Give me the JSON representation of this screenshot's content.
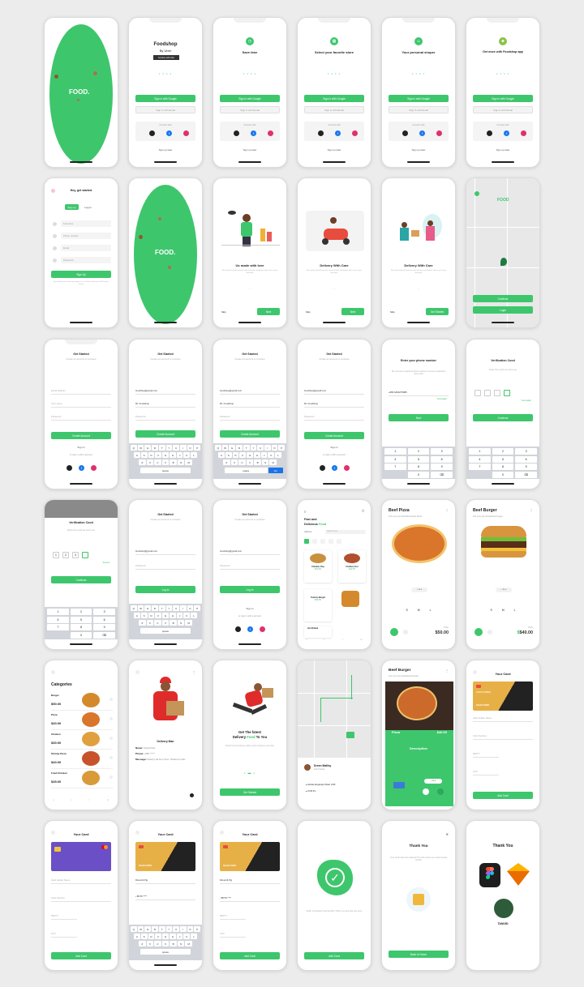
{
  "colors": {
    "accent": "#3ec66d",
    "background": "#ececec",
    "card_dark": "#222222",
    "card_gold": "#e7b046",
    "card_purple": "#6a4fc7"
  },
  "row1": {
    "splash_logo": "FOOD.",
    "foodshop_title": "Foodshop",
    "foodshop_by": "By Uber",
    "foodshop_badge": "Continue with Uber",
    "save_time": "Save time",
    "select_store": "Select your favorite store",
    "personal_shoper": "Your personal shoper",
    "get_more": "Get more with Foodshop app",
    "sign_in_google": "Sign in with Google",
    "sign_in_email": "Sign in with Email",
    "connect_with": "Connect with",
    "sign_up_later": "Sign up later"
  },
  "row2": {
    "get_started": "Hey, get started",
    "tab_signup": "Sign up",
    "tab_login": "Log in",
    "field_name": "Full name",
    "field_phone": "Phone number",
    "field_email": "Email",
    "field_password": "Password",
    "signup_button": "Sign Up",
    "terms": "By creating an account you agree to our Terms of Service and Privacy Policy",
    "splash_logo": "FOOD.",
    "onb1_title": "Us made with love",
    "onb2_title": "Delivery With Care",
    "onb3_title": "Delivery With Care",
    "onb_desc": "We make food with passion and sell them and deliver with care to your doorstep.",
    "skip": "Skip",
    "next": "Next",
    "get_started_btn": "Get Started",
    "map_logo": "FOOD",
    "map_btn1": "Continue",
    "map_btn2": "Login"
  },
  "row3": {
    "get_started": "Get Started",
    "get_started_sub": "Create an account to continue",
    "field_email": "Email address",
    "field_name": "Your name",
    "field_password": "Password",
    "email_value": "foodshop@gmail.com",
    "name_value": "Mr. Foodshop",
    "create_account": "Create Account",
    "sign_in": "Sign in",
    "or_sign_in": "or sign in with a account",
    "enter_phone": "Enter your phone number",
    "phone_sub": "We need your registered phone number to send you password reset code!",
    "phone_value": "+880  1826275985",
    "send_again": "Send again",
    "next": "Next",
    "verification": "Verification Cood",
    "verification_sub": "Enter the cood we sent you",
    "continue": "Continue",
    "code": [
      "1",
      "2",
      "3",
      "4"
    ],
    "keys_row1": [
      "Q",
      "W",
      "E",
      "R",
      "T",
      "Y",
      "U",
      "I",
      "O",
      "P"
    ],
    "keys_row2": [
      "A",
      "S",
      "D",
      "F",
      "G",
      "H",
      "J",
      "K",
      "L"
    ],
    "keys_row3": [
      "Z",
      "X",
      "C",
      "V",
      "B",
      "N",
      "M"
    ],
    "numpad": [
      "1",
      "2",
      "3",
      "4",
      "5",
      "6",
      "7",
      "8",
      "9",
      "",
      "0",
      "⌫"
    ]
  },
  "row4": {
    "verification": "Verification Cood",
    "verification_sub": "Enter the cood we sent you",
    "resend": "Resend",
    "continue": "Continue",
    "get_started": "Get Started",
    "login": "Log in",
    "sign_in": "Sign in",
    "or_sign_in": "or sign in with a account",
    "menu_title_1": "Fast and",
    "menu_title_2": "Delicious",
    "menu_title_food": "Food",
    "location": "Address",
    "search": "Search here",
    "item1": "Chicken Pop",
    "item1_price": "$10.50",
    "item2": "Chicken Hot",
    "item2_price": "$10.50",
    "item3": "Yummy Burger",
    "item3_price": "$10.50",
    "item4": "Hot Britani",
    "beef_pizza": "Beef Pizza",
    "beef_pizza_sub": "Our very own brandmeat beef pizza",
    "pizza_price": "$50.00",
    "beef_burger": "Beef Burger",
    "beef_burger_sub": "Our very own brandmeat burger",
    "burger_price": "$40.00",
    "sizes": [
      "S",
      "M",
      "L"
    ],
    "price_label": "Price"
  },
  "row5": {
    "categories": "Categories",
    "cat_items": [
      {
        "name": "Burger",
        "price": "$50.00"
      },
      {
        "name": "Pizza",
        "price": "$40.00"
      },
      {
        "name": "Chicken",
        "price": "$30.00"
      },
      {
        "name": "Shrimp Pizza",
        "price": "$40.00"
      },
      {
        "name": "Fried Chicken",
        "price": "$35.00"
      }
    ],
    "delivery_man": "Delivery Man",
    "dm_name_label": "Name:",
    "dm_name": "Tamjid Khan",
    "dm_phone_label": "Phone:",
    "dm_phone": "+880 ******",
    "dm_msg_label": "Message:",
    "dm_msg": "Delivery will be on time. Thanks for order.",
    "fast_title_1": "Get The fatest",
    "fast_title_2": "Delivery",
    "fast_title_food": "Food",
    "fast_title_3": "To You",
    "fast_desc": "Order food and delivery within a few minutes to your door",
    "get_started": "Get Started",
    "driver_name": "Dreen Malfoy",
    "driver_role": "Food Carrier",
    "address": "Ashulia Jamgorapur Road, 1345",
    "time": "15:30 Pm",
    "pizza_banner": "Pizza",
    "pizza_banner_price": "$40.00",
    "description": "Description",
    "your_card": "Your Card",
    "card_label": "CARD NUMBER",
    "card_holder": "Card Holder Name",
    "card_number": "Card Number",
    "mm_yy": "MM/YY",
    "cvv": "CVV",
    "add_card": "Add Card",
    "card_name_print": "SALIK FORR"
  },
  "row6": {
    "your_card": "Your Card",
    "card_holder": "Card Holder Name",
    "card_number": "Card Number",
    "mm_yy": "MM/YY",
    "cvv": "CVV",
    "add_card": "Add Card",
    "holder_value": "Dinamitt Pig",
    "number_value": "• 88 55 ****",
    "success_text": "Order Completed Successfully Thank you and see you soon",
    "thank_you": "Thank You",
    "thank_you_sub": "Your order has been placed! You will receive an email receipt shortly",
    "back_home": "Back to Home",
    "thank_you2": "Thank You",
    "author": "TAMJID"
  }
}
